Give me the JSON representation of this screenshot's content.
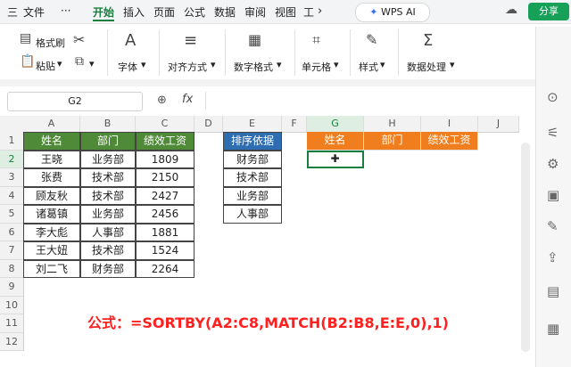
{
  "menu": {
    "hamburger": "三",
    "file": "文件",
    "more": "···",
    "tabs": [
      "开始",
      "插入",
      "页面",
      "公式",
      "数据",
      "审阅",
      "视图",
      "工"
    ],
    "wps_ai": "WPS AI",
    "share": "分享"
  },
  "ribbon": {
    "format_painter": "格式刷",
    "paste": "粘贴",
    "font": "字体",
    "align": "对齐方式",
    "number_format": "数字格式",
    "cell": "单元格",
    "style": "样式",
    "data_processing": "数据处理"
  },
  "formula_bar": {
    "name_box": "G2",
    "fx": "fx"
  },
  "grid": {
    "columns": [
      "A",
      "B",
      "C",
      "D",
      "E",
      "F",
      "G",
      "H",
      "I",
      "J"
    ],
    "rows": [
      "1",
      "2",
      "3",
      "4",
      "5",
      "6",
      "7",
      "8",
      "9",
      "10",
      "11",
      "12"
    ],
    "table1": {
      "headers": [
        "姓名",
        "部门",
        "绩效工资"
      ],
      "rows": [
        [
          "王晓",
          "业务部",
          "1809"
        ],
        [
          "张费",
          "技术部",
          "2150"
        ],
        [
          "顾友秋",
          "技术部",
          "2427"
        ],
        [
          "诸葛镇",
          "业务部",
          "2456"
        ],
        [
          "李大彪",
          "人事部",
          "1881"
        ],
        [
          "王大妞",
          "技术部",
          "1524"
        ],
        [
          "刘二飞",
          "财务部",
          "2264"
        ]
      ]
    },
    "sort_table": {
      "header": "排序依据",
      "items": [
        "财务部",
        "技术部",
        "业务部",
        "人事部"
      ]
    },
    "result_headers": [
      "姓名",
      "部门",
      "绩效工资"
    ]
  },
  "formula_note": "公式：=SORTBY(A2:C8,MATCH(B2:B8,E:E,0),1)"
}
